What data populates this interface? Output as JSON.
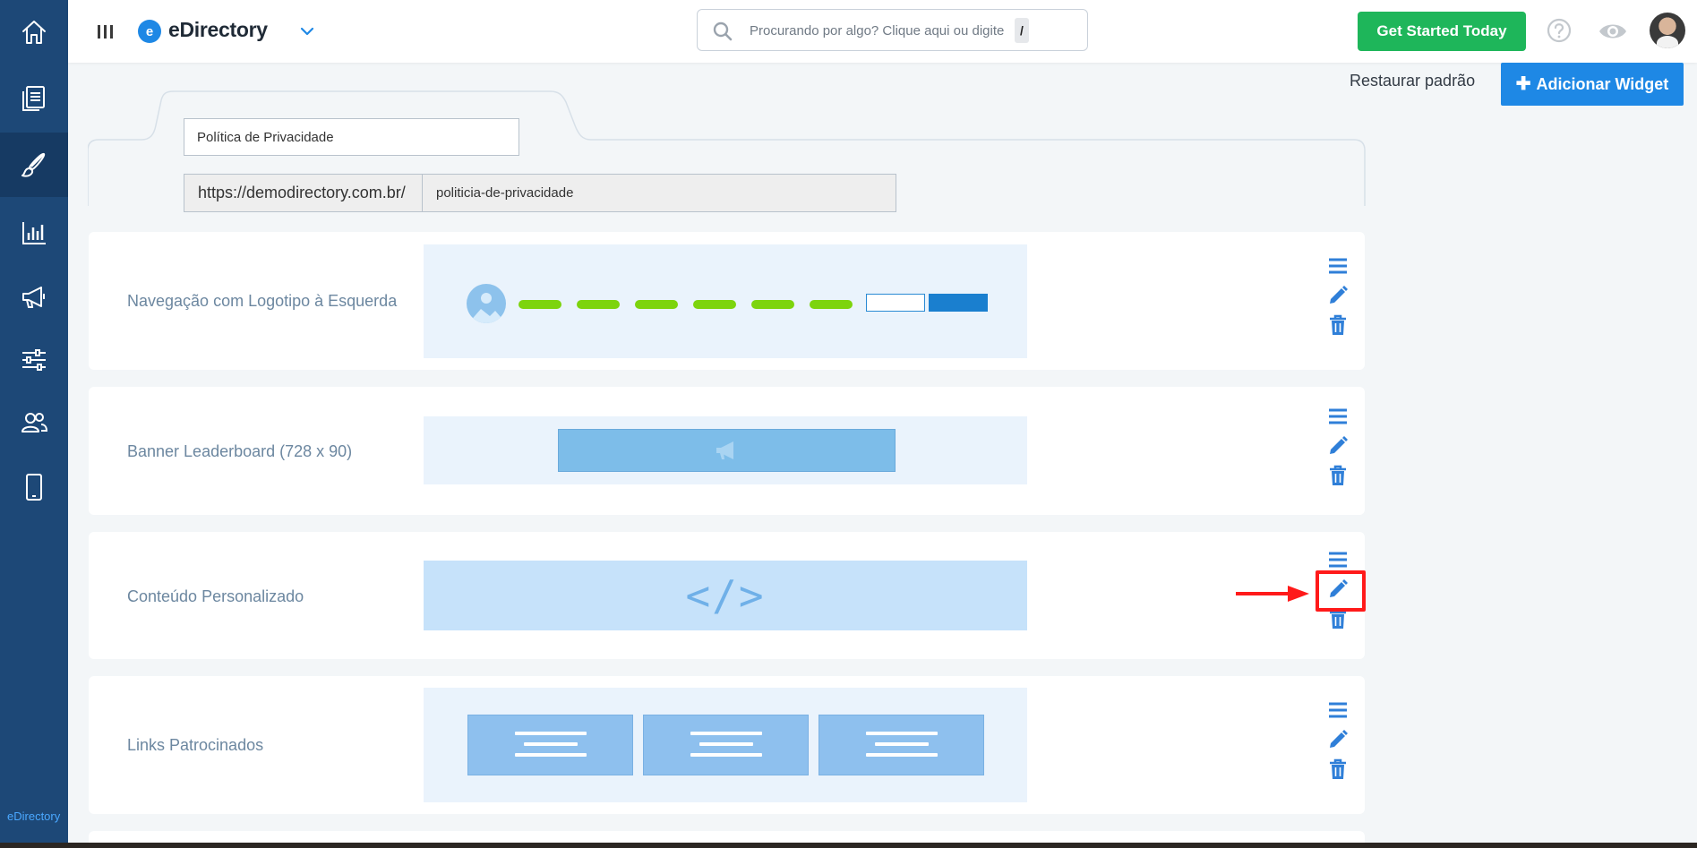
{
  "app": {
    "name": "eDirectory",
    "logo_letter": "e"
  },
  "sidebar": {
    "items": [
      {
        "icon": "home-icon"
      },
      {
        "icon": "pages-icon"
      },
      {
        "icon": "brush-icon",
        "active": true
      },
      {
        "icon": "chart-icon"
      },
      {
        "icon": "megaphone-icon"
      },
      {
        "icon": "sliders-icon"
      },
      {
        "icon": "users-icon"
      },
      {
        "icon": "mobile-icon"
      }
    ],
    "brand_footer": "eDirectory"
  },
  "header": {
    "search_placeholder": "Procurando por algo? Clique aqui ou digite",
    "search_shortcut": "/",
    "cta_label": "Get Started Today"
  },
  "toolbar": {
    "restore_label": "Restaurar padrão",
    "add_widget_label": "Adicionar Widget"
  },
  "page": {
    "title_value": "Política de Privacidade",
    "url_prefix": "https://demodirectory.com.br/",
    "url_slug": "politicia-de-privacidade"
  },
  "widgets": [
    {
      "label": "Navegação com Logotipo à Esquerda",
      "preview": "navigation"
    },
    {
      "label": "Banner Leaderboard (728 x 90)",
      "preview": "banner"
    },
    {
      "label": "Conteúdo Personalizado",
      "preview": "custom-code",
      "code_glyph": "</>",
      "highlighted_action": "edit"
    },
    {
      "label": "Links Patrocinados",
      "preview": "sponsored-links"
    }
  ],
  "colors": {
    "sidebar": "#1d4877",
    "accent_blue": "#1e88e5",
    "cta_green": "#1eb65a",
    "highlight_red": "#ff1a1a",
    "action_icon": "#2f7fd8"
  }
}
